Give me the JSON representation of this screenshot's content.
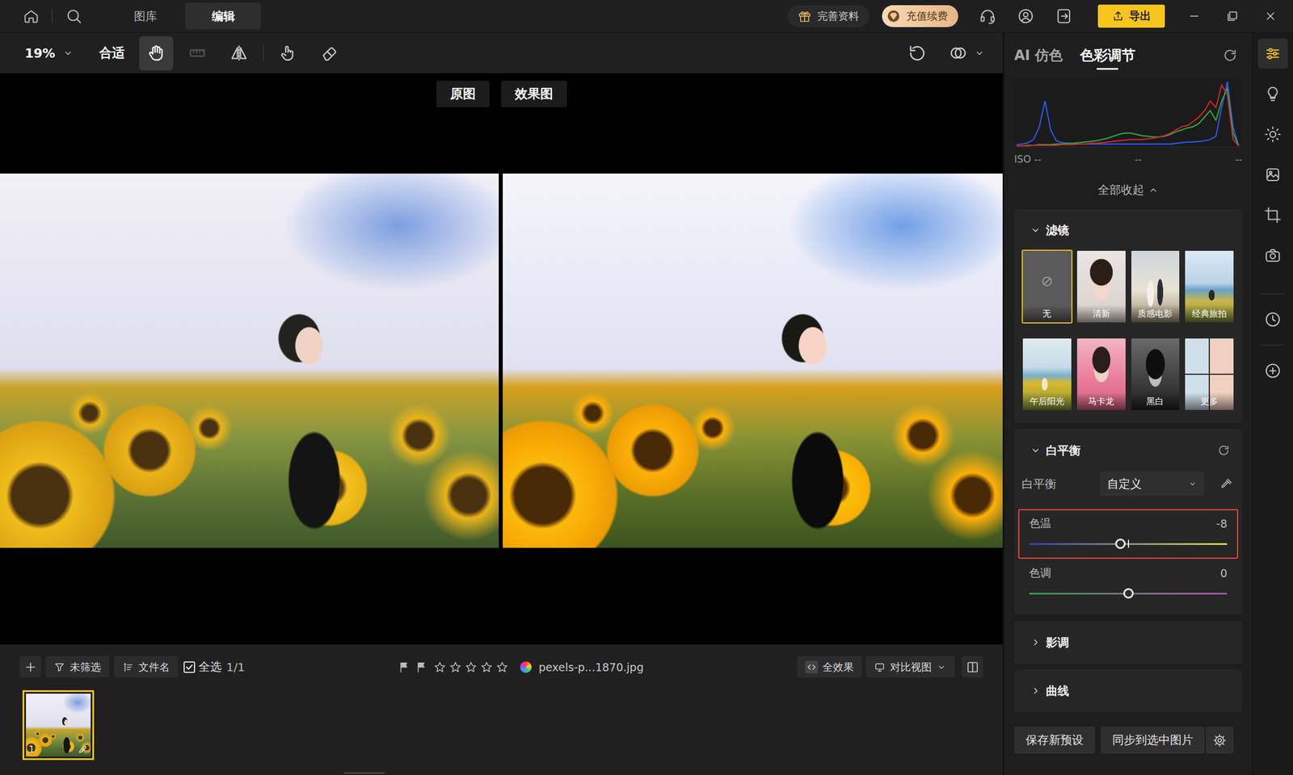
{
  "topbar": {
    "nav": [
      {
        "label": "图库",
        "selected": false
      },
      {
        "label": "编辑",
        "selected": true
      }
    ],
    "profile": "完善资料",
    "recharge": "充值续费",
    "export": "导出"
  },
  "toolbar": {
    "zoom": "19%",
    "fit": "合适",
    "tools": [
      {
        "kind": "hand",
        "selected": true,
        "disabled": false
      },
      {
        "kind": "ruler",
        "selected": false,
        "disabled": true
      },
      {
        "kind": "flip",
        "selected": false,
        "disabled": false
      },
      {
        "kind": "touch",
        "selected": false,
        "disabled": false
      },
      {
        "kind": "eraser",
        "selected": false,
        "disabled": false
      }
    ]
  },
  "canvas": {
    "views": [
      "原图",
      "效果图"
    ]
  },
  "filmstrip": {
    "filter": "未筛选",
    "sort": "文件名",
    "select_all": {
      "label": "全选",
      "checked": true
    },
    "count": "1/1",
    "stars": 0,
    "filename": "pexels-p...1870.jpg",
    "effect": "全效果",
    "view": "对比视图",
    "thumbnails": [
      {
        "number": "1",
        "selected": true,
        "edited": true
      }
    ]
  },
  "panel": {
    "tabs": [
      {
        "label": "AI 仿色",
        "selected": false
      },
      {
        "label": "色彩调节",
        "selected": true
      }
    ],
    "histogram": {
      "series": [
        {
          "color": "#2d5bff",
          "values": [
            2,
            3,
            5,
            10,
            30,
            70,
            25,
            8,
            5,
            4,
            4,
            3,
            3,
            3,
            3,
            3,
            3,
            3,
            3,
            3,
            3,
            3,
            3,
            3,
            3,
            3,
            3,
            3,
            4,
            5,
            6,
            6,
            7,
            8,
            10,
            15,
            60,
            100,
            30,
            0
          ]
        },
        {
          "color": "#2bb041",
          "values": [
            0,
            0,
            1,
            1,
            2,
            2,
            2,
            3,
            3,
            4,
            4,
            5,
            6,
            7,
            8,
            10,
            12,
            15,
            18,
            20,
            20,
            18,
            16,
            15,
            14,
            14,
            15,
            18,
            22,
            25,
            28,
            30,
            35,
            45,
            55,
            40,
            70,
            90,
            20,
            0
          ]
        },
        {
          "color": "#d8262d",
          "values": [
            0,
            0,
            0,
            1,
            1,
            1,
            1,
            1,
            2,
            2,
            2,
            3,
            3,
            4,
            4,
            5,
            6,
            7,
            8,
            9,
            10,
            10,
            10,
            11,
            12,
            14,
            16,
            20,
            25,
            30,
            32,
            38,
            45,
            55,
            70,
            60,
            95,
            80,
            10,
            0
          ]
        }
      ],
      "iso": "ISO --",
      "readings": [
        "--",
        "--"
      ]
    },
    "collapse_all": "全部收起",
    "filters": {
      "title": "滤镜",
      "expanded": true,
      "items": [
        {
          "label": "无",
          "selected": true
        },
        {
          "label": "清新",
          "selected": false
        },
        {
          "label": "质感电影",
          "selected": false
        },
        {
          "label": "经典旅拍",
          "selected": false
        },
        {
          "label": "午后阳光",
          "selected": false
        },
        {
          "label": "马卡龙",
          "selected": false
        },
        {
          "label": "黑白",
          "selected": false
        },
        {
          "label": "更多",
          "selected": false
        }
      ]
    },
    "white_balance": {
      "title": "白平衡",
      "expanded": true,
      "mode_label": "白平衡",
      "mode": "自定义",
      "sliders": [
        {
          "label": "色温",
          "reading": "-8",
          "level": 0.46,
          "highlighted": true,
          "color_start": "#3a3fb0",
          "color_end": "#d8d84a"
        },
        {
          "label": "色调",
          "reading": "0",
          "level": 0.5,
          "highlighted": false,
          "color_start": "#2f9e4a",
          "color_end": "#b04ab0"
        }
      ]
    },
    "collapsed_sections": [
      {
        "title": "影调",
        "expanded": false
      },
      {
        "title": "曲线",
        "expanded": false
      }
    ],
    "buttons": [
      "保存新预设",
      "同步到选中图片"
    ]
  },
  "rail": [
    {
      "kind": "adjust",
      "selected": true
    },
    {
      "kind": "retouch",
      "selected": false
    },
    {
      "kind": "light",
      "selected": false
    },
    {
      "kind": "portrait",
      "selected": false
    },
    {
      "kind": "crop",
      "selected": false
    },
    {
      "kind": "camera",
      "selected": false
    },
    {
      "kind": "history",
      "selected": false
    },
    {
      "kind": "add",
      "selected": false
    }
  ]
}
